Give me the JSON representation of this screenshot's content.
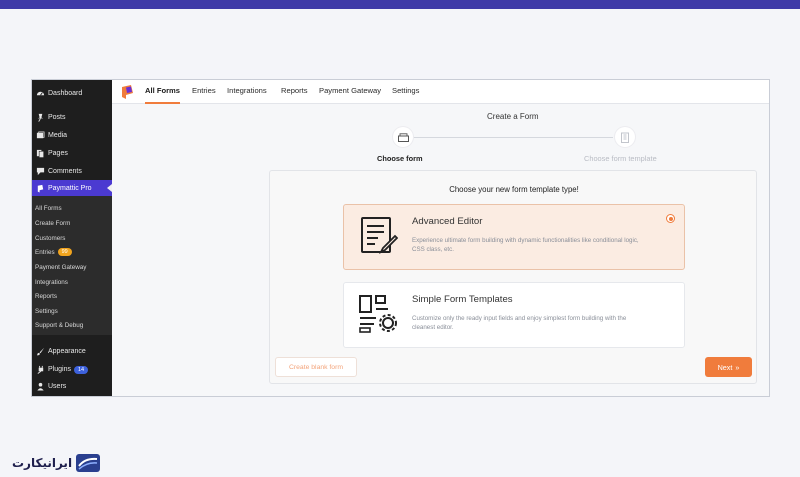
{
  "sidebar": {
    "items": [
      {
        "label": "Dashboard",
        "icon": "dashboard-icon"
      },
      {
        "label": "Posts",
        "icon": "pin-icon"
      },
      {
        "label": "Media",
        "icon": "media-icon"
      },
      {
        "label": "Pages",
        "icon": "pages-icon"
      },
      {
        "label": "Comments",
        "icon": "comments-icon"
      },
      {
        "label": "Paymattic Pro",
        "icon": "paymattic-icon"
      }
    ],
    "submenu": [
      {
        "label": "All Forms"
      },
      {
        "label": "Create Form"
      },
      {
        "label": "Customers"
      },
      {
        "label": "Entries",
        "badge": "99"
      },
      {
        "label": "Payment Gateway"
      },
      {
        "label": "Integrations"
      },
      {
        "label": "Reports"
      },
      {
        "label": "Settings"
      },
      {
        "label": "Support & Debug"
      }
    ],
    "bottom_items": [
      {
        "label": "Appearance",
        "icon": "brush-icon"
      },
      {
        "label": "Plugins",
        "icon": "plugin-icon",
        "badge": "14"
      },
      {
        "label": "Users",
        "icon": "user-icon"
      }
    ]
  },
  "nav": {
    "tabs": [
      "All Forms",
      "Entries",
      "Integrations",
      "Reports",
      "Payment Gateway",
      "Settings"
    ],
    "active_tab": "All Forms"
  },
  "main": {
    "title": "Create a Form",
    "steps": [
      {
        "label": "Choose form",
        "active": true
      },
      {
        "label": "Choose form template",
        "active": false
      }
    ],
    "panel_title": "Choose your new form template type!",
    "options": [
      {
        "title": "Advanced Editor",
        "description": "Experience ultimate form building with dynamic functionalities like conditional logic, CSS class, etc.",
        "selected": true
      },
      {
        "title": "Simple Form Templates",
        "description": "Customize only the ready input fields and enjoy simplest form building with the cleanest editor.",
        "selected": false
      }
    ],
    "blank_button": "Create blank form",
    "next_button": "Next",
    "next_icon": "»"
  },
  "brand": {
    "name": "ایرانیکارت"
  },
  "colors": {
    "accent": "#f07c3c",
    "sidebar": "#1e1e1e",
    "sidebar_active": "#4b3ad1",
    "topbar": "#3f3aa8"
  }
}
